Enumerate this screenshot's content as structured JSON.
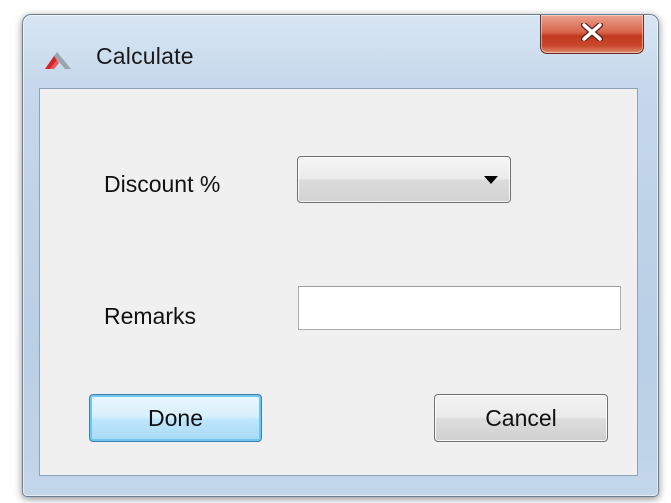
{
  "window": {
    "title": "Calculate",
    "icon": "app-logo-icon",
    "close_icon": "close-icon",
    "close_glyph": "X",
    "close_color": "#c8452b"
  },
  "form": {
    "discount": {
      "label": "Discount %",
      "value": "",
      "icon": "chevron-down-icon"
    },
    "remarks": {
      "label": "Remarks",
      "value": "",
      "placeholder": ""
    }
  },
  "buttons": {
    "done_label": "Done",
    "cancel_label": "Cancel",
    "default_accent": "#3c7fb1"
  }
}
